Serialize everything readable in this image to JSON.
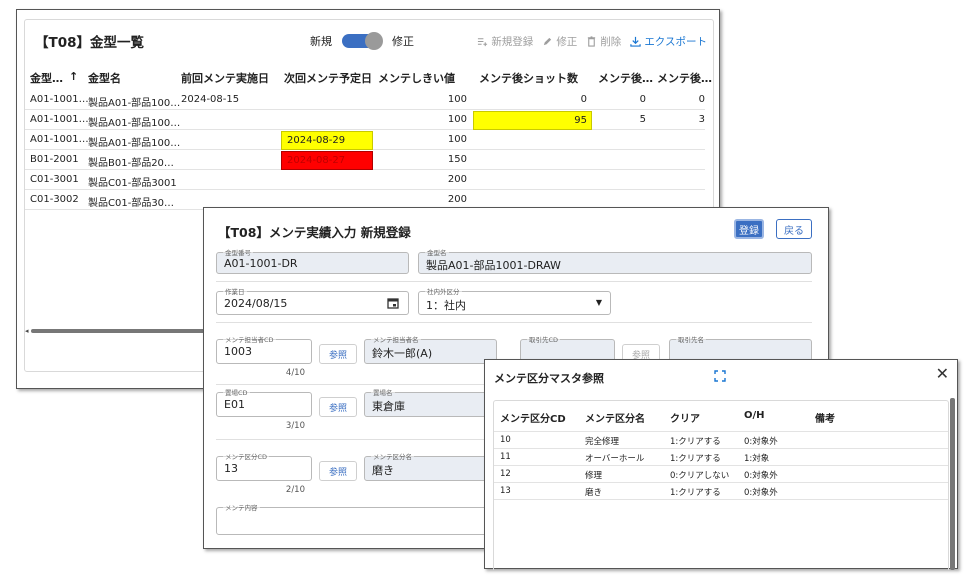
{
  "list_window": {
    "title": "【T08】金型一覧",
    "toggle": {
      "left_label": "新規",
      "right_label": "修正"
    },
    "toolbar": {
      "new": "新規登録",
      "edit": "修正",
      "delete": "削除",
      "export": "エクスポート"
    },
    "columns": [
      "金型…",
      "金型名",
      "前回メンテ実施日",
      "次回メンテ予定日",
      "メンテしきい値",
      "メンテ後ショット数",
      "メンテ後…",
      "メンテ後…"
    ],
    "sort_indicator": "↑",
    "rows": [
      {
        "code": "A01-1001…",
        "name": "製品A01-部品100…",
        "prev": "2024-08-15",
        "next": "",
        "threshold": "100",
        "shots": "0",
        "c7": "0",
        "c8": "0"
      },
      {
        "code": "A01-1001…",
        "name": "製品A01-部品100…",
        "prev": "",
        "next": "",
        "threshold": "100",
        "shots": "95",
        "c7": "5",
        "c8": "3"
      },
      {
        "code": "A01-1001…",
        "name": "製品A01-部品100…",
        "prev": "",
        "next": "2024-08-29",
        "threshold": "100",
        "shots": "",
        "c7": "",
        "c8": ""
      },
      {
        "code": "B01-2001",
        "name": "製品B01-部品20…",
        "prev": "",
        "next": "2024-08-27",
        "threshold": "150",
        "shots": "",
        "c7": "",
        "c8": ""
      },
      {
        "code": "C01-3001",
        "name": "製品C01-部品3001",
        "prev": "",
        "next": "",
        "threshold": "200",
        "shots": "",
        "c7": "",
        "c8": ""
      },
      {
        "code": "C01-3002",
        "name": "製品C01-部品30…",
        "prev": "",
        "next": "",
        "threshold": "200",
        "shots": "",
        "c7": "",
        "c8": ""
      }
    ]
  },
  "entry_window": {
    "title": "【T08】メンテ実績入力 新規登録",
    "register_button": "登録",
    "back_button": "戻る",
    "fields": {
      "mold_no": {
        "label": "金型番号",
        "value": "A01-1001-DR"
      },
      "mold_name": {
        "label": "金型名",
        "value": "製品A01-部品1001-DRAW"
      },
      "work_date": {
        "label": "作業日",
        "value": "2024/08/15"
      },
      "in_out": {
        "label": "社内外区分",
        "value": "1：社内"
      },
      "staff_cd": {
        "label": "メンテ担当者CD",
        "value": "1003",
        "counter": "4/10"
      },
      "staff_name": {
        "label": "メンテ担当者名",
        "value": "鈴木一郎(A)"
      },
      "vendor_cd": {
        "label": "取引先CD",
        "value": ""
      },
      "vendor_name": {
        "label": "取引先名",
        "value": ""
      },
      "location_cd": {
        "label": "置場CD",
        "value": "E01",
        "counter": "3/10"
      },
      "location_name": {
        "label": "置場名",
        "value": "東倉庫"
      },
      "maint_type_cd": {
        "label": "メンテ区分CD",
        "value": "13",
        "counter": "2/10"
      },
      "maint_type_name": {
        "label": "メンテ区分名",
        "value": "磨き"
      },
      "content": {
        "label": "メンテ内容",
        "value": ""
      }
    },
    "ref_button": "参照"
  },
  "ref_window": {
    "title": "メンテ区分マスタ参照",
    "columns": [
      "メンテ区分CD",
      "メンテ区分名",
      "クリア",
      "O/H",
      "備考"
    ],
    "rows": [
      {
        "cd": "10",
        "name": "完全修理",
        "clear": "1:クリアする",
        "oh": "0:対象外",
        "note": ""
      },
      {
        "cd": "11",
        "name": "オーバーホール",
        "clear": "1:クリアする",
        "oh": "1:対象",
        "note": ""
      },
      {
        "cd": "12",
        "name": "修理",
        "clear": "0:クリアしない",
        "oh": "0:対象外",
        "note": ""
      },
      {
        "cd": "13",
        "name": "磨き",
        "clear": "1:クリアする",
        "oh": "0:対象外",
        "note": ""
      }
    ]
  }
}
